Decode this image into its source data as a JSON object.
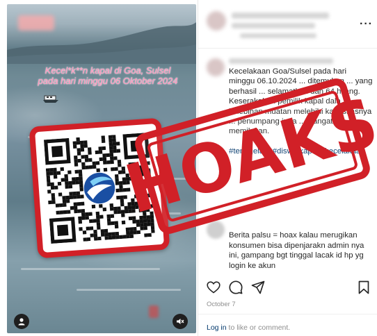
{
  "video": {
    "caption_line1": "Kecel*k**n kapal di Goa, Sulsel",
    "caption_line2": "pada hari minggu 06 Oktober 2024"
  },
  "post": {
    "body": "Kecelakaan Goa/Sulsel pada hari minggu 06.10.2024 ... ditemukan ... yang berhasil ... selamatkan dan 64 hilang. Keserakahan pemilik kapal dala kelebihan muatan melebihi kapasitasnya ... penumpang juga ... Sangat memilukan.",
    "hashtags": "#tenggelam #disw #kapal #kecelakaan",
    "comment": "Berita palsu = hoax kalau merugikan konsumen bisa dipenjarakn admin nya ini, gampang bgt tinggal lacak id hp yg login ke akun",
    "date": "October 7",
    "login_link": "Log in",
    "login_rest": " to like or comment."
  },
  "stamp": {
    "label": "HOAKS",
    "color": "#d12027"
  },
  "icons": [
    "more-icon",
    "heart-icon",
    "comment-icon",
    "share-icon",
    "bookmark-icon",
    "profile-icon",
    "mute-icon",
    "qr-code-icon"
  ]
}
